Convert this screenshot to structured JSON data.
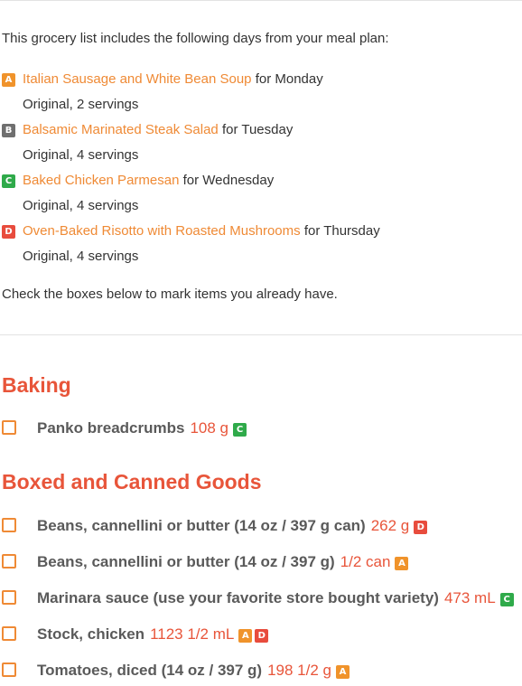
{
  "intro_text": "This grocery list includes the following days from your meal plan:",
  "meals": [
    {
      "badge": "A",
      "recipe": "Italian Sausage and White Bean Soup",
      "day": "for Monday",
      "servings": "Original, 2 servings"
    },
    {
      "badge": "B",
      "recipe": "Balsamic Marinated Steak Salad",
      "day": "for Tuesday",
      "servings": "Original, 4 servings"
    },
    {
      "badge": "C",
      "recipe": "Baked Chicken Parmesan",
      "day": "for Wednesday",
      "servings": "Original, 4 servings"
    },
    {
      "badge": "D",
      "recipe": "Oven-Baked Risotto with Roasted Mushrooms",
      "day": "for Thursday",
      "servings": "Original, 4 servings"
    }
  ],
  "note_text": "Check the boxes below to mark items you already have.",
  "sections": [
    {
      "title": "Baking",
      "items": [
        {
          "name": "Panko breadcrumbs",
          "qty": "108 g",
          "badges": [
            "C"
          ]
        }
      ]
    },
    {
      "title": "Boxed and Canned Goods",
      "items": [
        {
          "name": "Beans, cannellini or butter (14 oz / 397 g can)",
          "qty": "262 g",
          "badges": [
            "D"
          ]
        },
        {
          "name": "Beans, cannellini or butter (14 oz / 397 g)",
          "qty": "1/2 can",
          "badges": [
            "A"
          ]
        },
        {
          "name": "Marinara sauce (use your favorite store bought variety)",
          "qty": "473 mL",
          "badges": [
            "C"
          ]
        },
        {
          "name": "Stock, chicken",
          "qty": "1123 1/2 mL",
          "badges": [
            "A",
            "D"
          ]
        },
        {
          "name": "Tomatoes, diced (14 oz / 397 g)",
          "qty": "198 1/2 g",
          "badges": [
            "A"
          ]
        }
      ]
    }
  ],
  "colors": {
    "accent_orange": "#ef8a35",
    "section_red": "#e8553a",
    "badge_A": "#f0932b",
    "badge_B": "#6f6f6f",
    "badge_C": "#2faa4a",
    "badge_D": "#e84c3d"
  }
}
